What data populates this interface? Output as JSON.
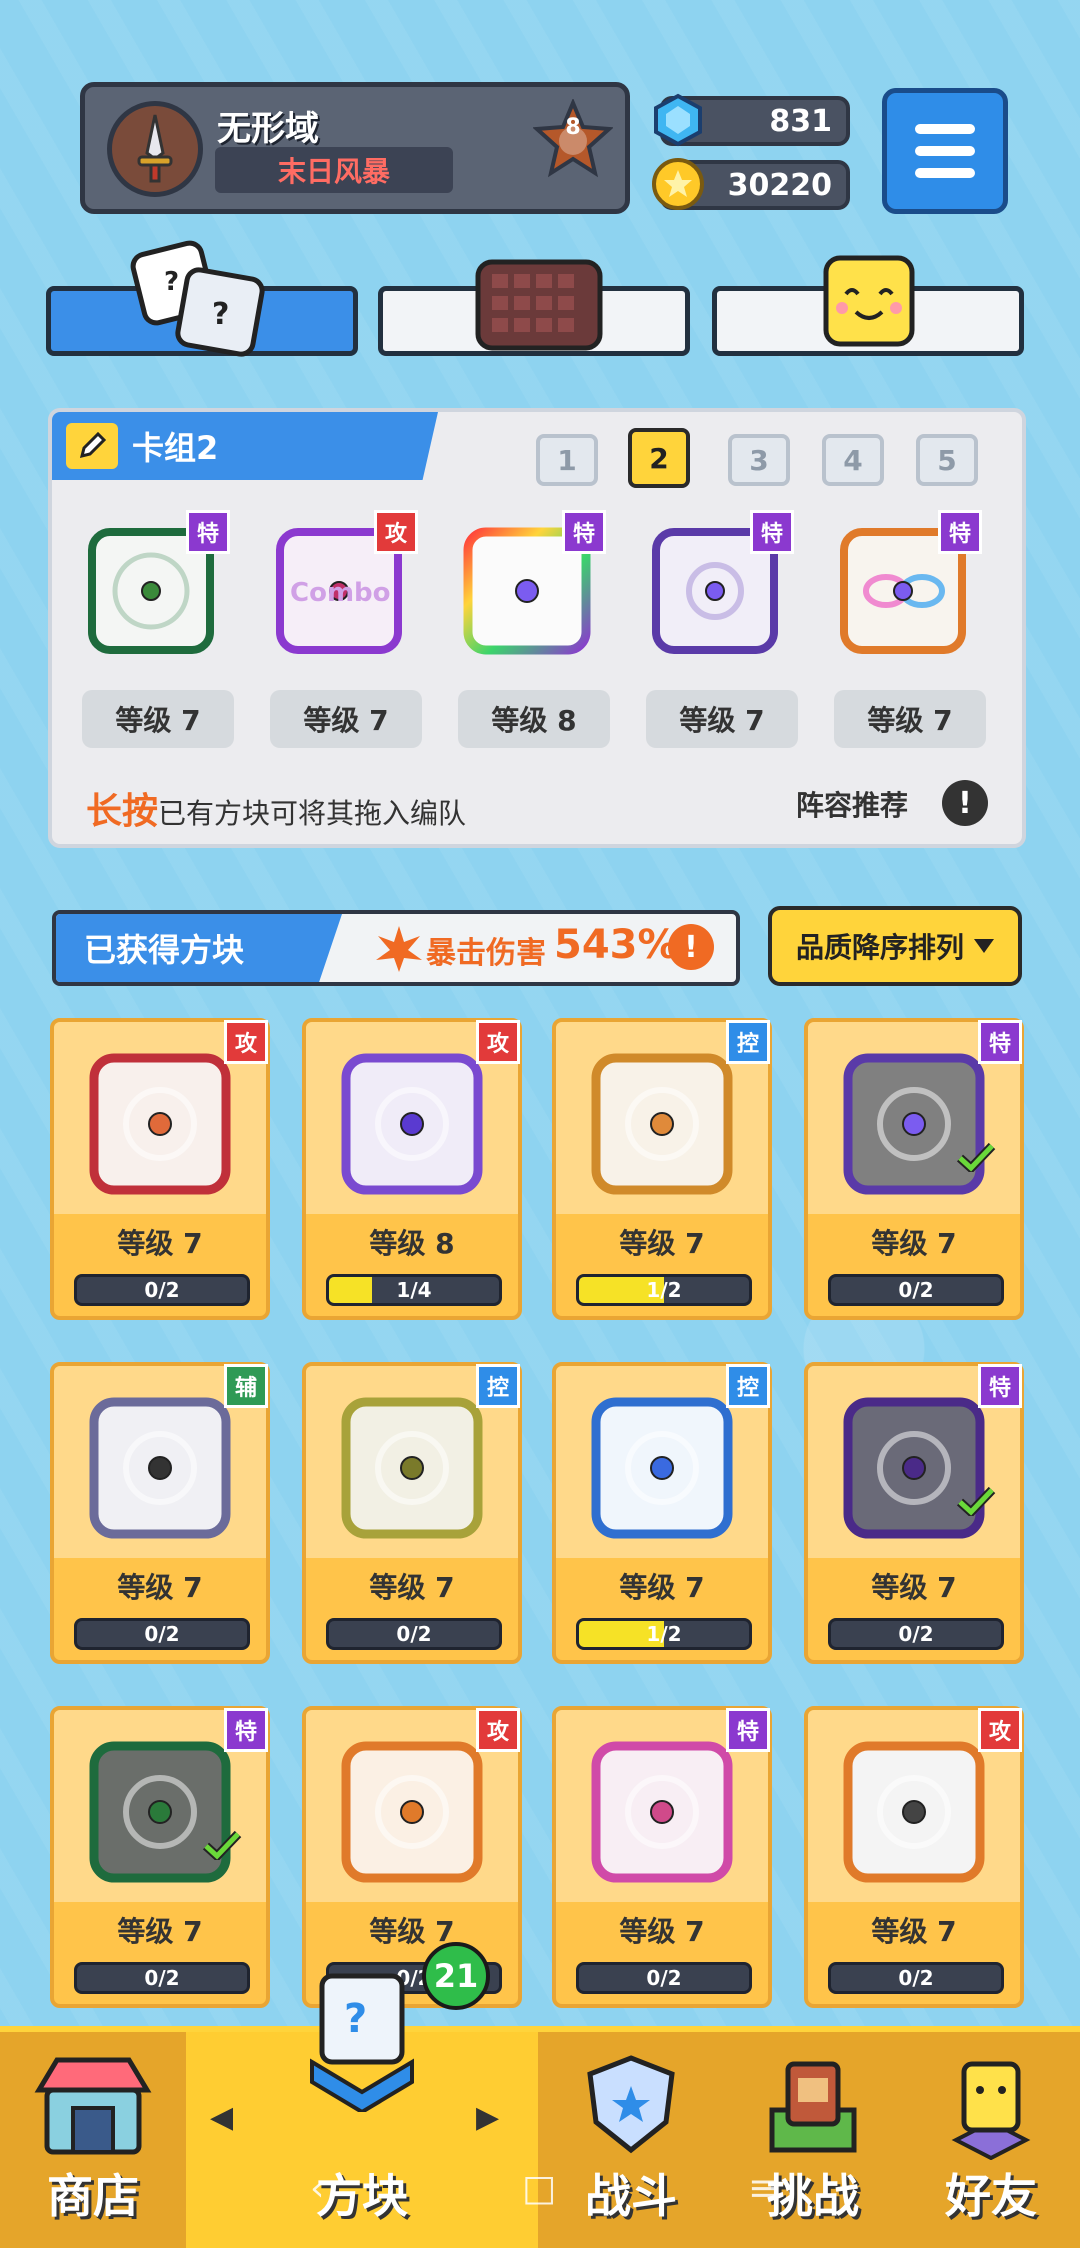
{
  "player": {
    "name": "无形域",
    "title": "末日风暴",
    "rank": "8"
  },
  "currency": {
    "gems": "831",
    "coins": "30220"
  },
  "colors": {
    "accent_blue": "#3b8fe8",
    "gold": "#ffd43b",
    "bg": "#8ed3f0"
  },
  "deck": {
    "title": "卡组2",
    "tabs": [
      "1",
      "2",
      "3",
      "4",
      "5"
    ],
    "active_tab": "2",
    "slots": [
      {
        "tag": "特",
        "level": "等级 7",
        "icon": "pentagram-dice-icon"
      },
      {
        "tag": "攻",
        "level": "等级 7",
        "icon": "combo-dice-icon",
        "text": "Combo"
      },
      {
        "tag": "特",
        "level": "等级 8",
        "icon": "rainbow-dice-icon"
      },
      {
        "tag": "特",
        "level": "等级 7",
        "icon": "cycle-dice-icon"
      },
      {
        "tag": "特",
        "level": "等级 7",
        "icon": "infinity-dice-icon"
      }
    ],
    "hint_em": "长按",
    "hint_rest": "已有方块可将其拖入编队",
    "recommend": "阵容推荐",
    "info": "!"
  },
  "obtained": {
    "label": "已获得方块",
    "crit_label": "暴击伤害",
    "crit_value": "543%",
    "info": "!",
    "sort_label": "品质降序排列",
    "cards": [
      {
        "tag": "攻",
        "level": "等级 7",
        "progress": "0/2",
        "fill": 0
      },
      {
        "tag": "攻",
        "level": "等级 8",
        "progress": "1/4",
        "fill": 0.25
      },
      {
        "tag": "控",
        "level": "等级 7",
        "progress": "1/2",
        "fill": 0.5
      },
      {
        "tag": "特",
        "level": "等级 7",
        "progress": "0/2",
        "fill": 0,
        "equipped": true
      },
      {
        "tag": "辅",
        "level": "等级 7",
        "progress": "0/2",
        "fill": 0
      },
      {
        "tag": "控",
        "level": "等级 7",
        "progress": "0/2",
        "fill": 0
      },
      {
        "tag": "控",
        "level": "等级 7",
        "progress": "1/2",
        "fill": 0.5
      },
      {
        "tag": "特",
        "level": "等级 7",
        "progress": "0/2",
        "fill": 0,
        "equipped": true
      },
      {
        "tag": "特",
        "level": "等级 7",
        "progress": "0/2",
        "fill": 0,
        "equipped": true
      },
      {
        "tag": "攻",
        "level": "等级 7",
        "progress": "0/2",
        "fill": 0
      },
      {
        "tag": "特",
        "level": "等级 7",
        "progress": "0/2",
        "fill": 0
      },
      {
        "tag": "攻",
        "level": "等级 7",
        "progress": "0/2",
        "fill": 0
      }
    ]
  },
  "nav": {
    "items": [
      "商店",
      "方块",
      "战斗",
      "挑战",
      "好友"
    ],
    "active": "方块",
    "badge": "21"
  }
}
